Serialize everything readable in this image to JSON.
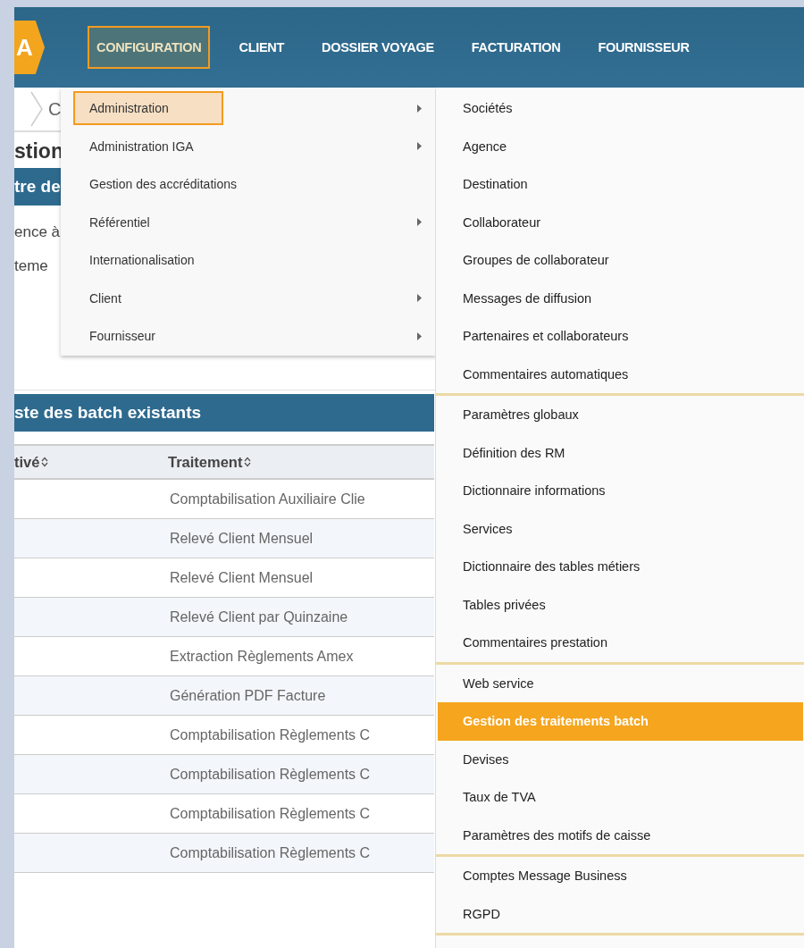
{
  "logo": {
    "text": "A"
  },
  "nav": [
    {
      "label": "CONFIGURATION",
      "selected": true
    },
    {
      "label": "CLIENT",
      "selected": false
    },
    {
      "label": "DOSSIER VOYAGE",
      "selected": false
    },
    {
      "label": "FACTURATION",
      "selected": false
    },
    {
      "label": "FOURNISSEUR",
      "selected": false
    }
  ],
  "breadcrumb": {
    "text": "C"
  },
  "page_title": "stion",
  "panel": {
    "title": "tre de",
    "lines": [
      "ence à",
      "teme"
    ]
  },
  "table": {
    "title": "ste des batch existants",
    "columns": [
      "tivé",
      "Traitement"
    ],
    "rows": [
      "Comptabilisation Auxiliaire Clie",
      "Relevé Client Mensuel",
      "Relevé Client Mensuel",
      "Relevé Client par Quinzaine",
      "Extraction Règlements Amex",
      "Génération PDF Facture",
      "Comptabilisation Règlements C",
      "Comptabilisation Règlements C",
      "Comptabilisation Règlements C",
      "Comptabilisation Règlements C"
    ]
  },
  "menu": [
    {
      "label": "Administration",
      "selected": true,
      "has_submenu": true
    },
    {
      "label": "Administration IGA",
      "selected": false,
      "has_submenu": true
    },
    {
      "label": "Gestion des accréditations",
      "selected": false,
      "has_submenu": false
    },
    {
      "label": "Référentiel",
      "selected": false,
      "has_submenu": true
    },
    {
      "label": "Internationalisation",
      "selected": false,
      "has_submenu": false
    },
    {
      "label": "Client",
      "selected": false,
      "has_submenu": true
    },
    {
      "label": "Fournisseur",
      "selected": false,
      "has_submenu": true
    }
  ],
  "submenu": [
    {
      "items": [
        {
          "label": "Sociétés",
          "selected": false
        },
        {
          "label": "Agence",
          "selected": false
        },
        {
          "label": "Destination",
          "selected": false
        },
        {
          "label": "Collaborateur",
          "selected": false
        },
        {
          "label": "Groupes de collaborateur",
          "selected": false
        },
        {
          "label": "Messages de diffusion",
          "selected": false
        },
        {
          "label": "Partenaires et collaborateurs",
          "selected": false
        },
        {
          "label": "Commentaires automatiques",
          "selected": false
        }
      ]
    },
    {
      "items": [
        {
          "label": "Paramètres globaux",
          "selected": false
        },
        {
          "label": "Définition des RM",
          "selected": false
        },
        {
          "label": "Dictionnaire informations",
          "selected": false
        },
        {
          "label": "Services",
          "selected": false
        },
        {
          "label": "Dictionnaire des tables métiers",
          "selected": false
        },
        {
          "label": "Tables privées",
          "selected": false
        },
        {
          "label": "Commentaires prestation",
          "selected": false
        }
      ]
    },
    {
      "items": [
        {
          "label": "Web service",
          "selected": false
        },
        {
          "label": "Gestion des traitements batch",
          "selected": true
        },
        {
          "label": "Devises",
          "selected": false
        },
        {
          "label": "Taux de TVA",
          "selected": false
        },
        {
          "label": "Paramètres des motifs de caisse",
          "selected": false
        }
      ]
    },
    {
      "items": [
        {
          "label": "Comptes Message Business",
          "selected": false
        },
        {
          "label": "RGPD",
          "selected": false
        }
      ]
    }
  ]
}
